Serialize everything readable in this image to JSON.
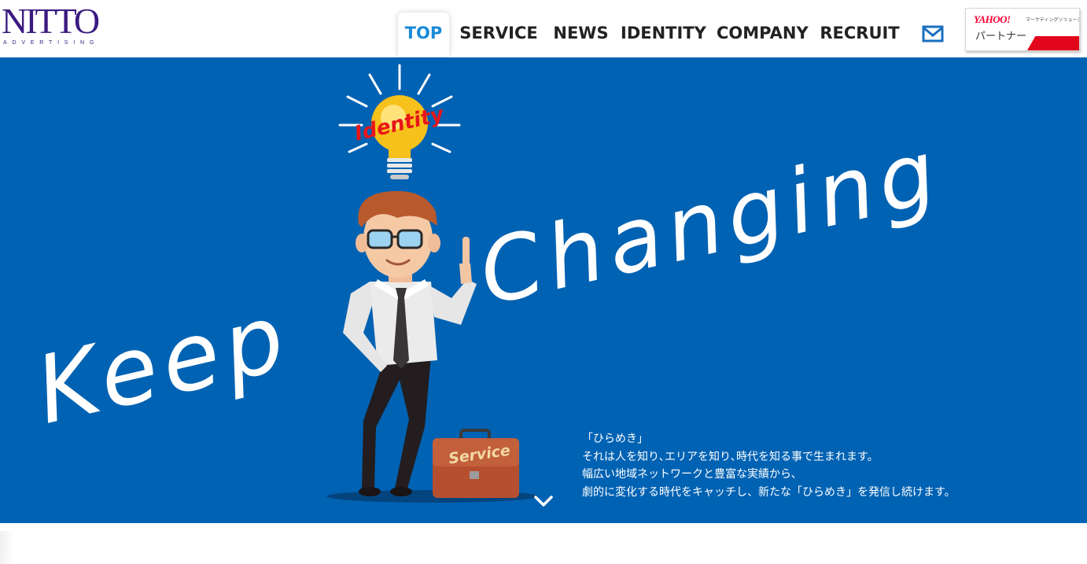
{
  "logo": {
    "word": "NITTO",
    "sub": "ADVERTISING"
  },
  "nav": {
    "items": [
      {
        "label": "TOP",
        "active": true
      },
      {
        "label": "SERVICE",
        "active": false
      },
      {
        "label": "NEWS",
        "active": false
      },
      {
        "label": "IDENTITY",
        "active": false
      },
      {
        "label": "COMPANY",
        "active": false
      },
      {
        "label": "RECRUIT",
        "active": false
      }
    ],
    "mail_icon": "mail-icon"
  },
  "yahoo_badge": {
    "logo": "YAHOO!",
    "solution": "マーケティングソリューション",
    "partner": "パートナー"
  },
  "hero": {
    "headline_1": "Keep",
    "headline_2": "Changing",
    "bulb_label": "Identity",
    "case_label": "Service",
    "copy": [
      "「ひらめき」",
      "それは人を知り､エリアを知り､時代を知る事で生まれます。",
      "幅広い地域ネットワークと豊富な実績から､",
      "劇的に変化する時代をキャッチし、新たな「ひらめき」を発信し続けます。"
    ],
    "scroll_icon": "chevron-down-icon"
  },
  "colors": {
    "hero_bg": "#0062b3",
    "nav_active": "#1a8ad8",
    "logo": "#3a1a80",
    "yahoo_red": "#e2061b"
  }
}
